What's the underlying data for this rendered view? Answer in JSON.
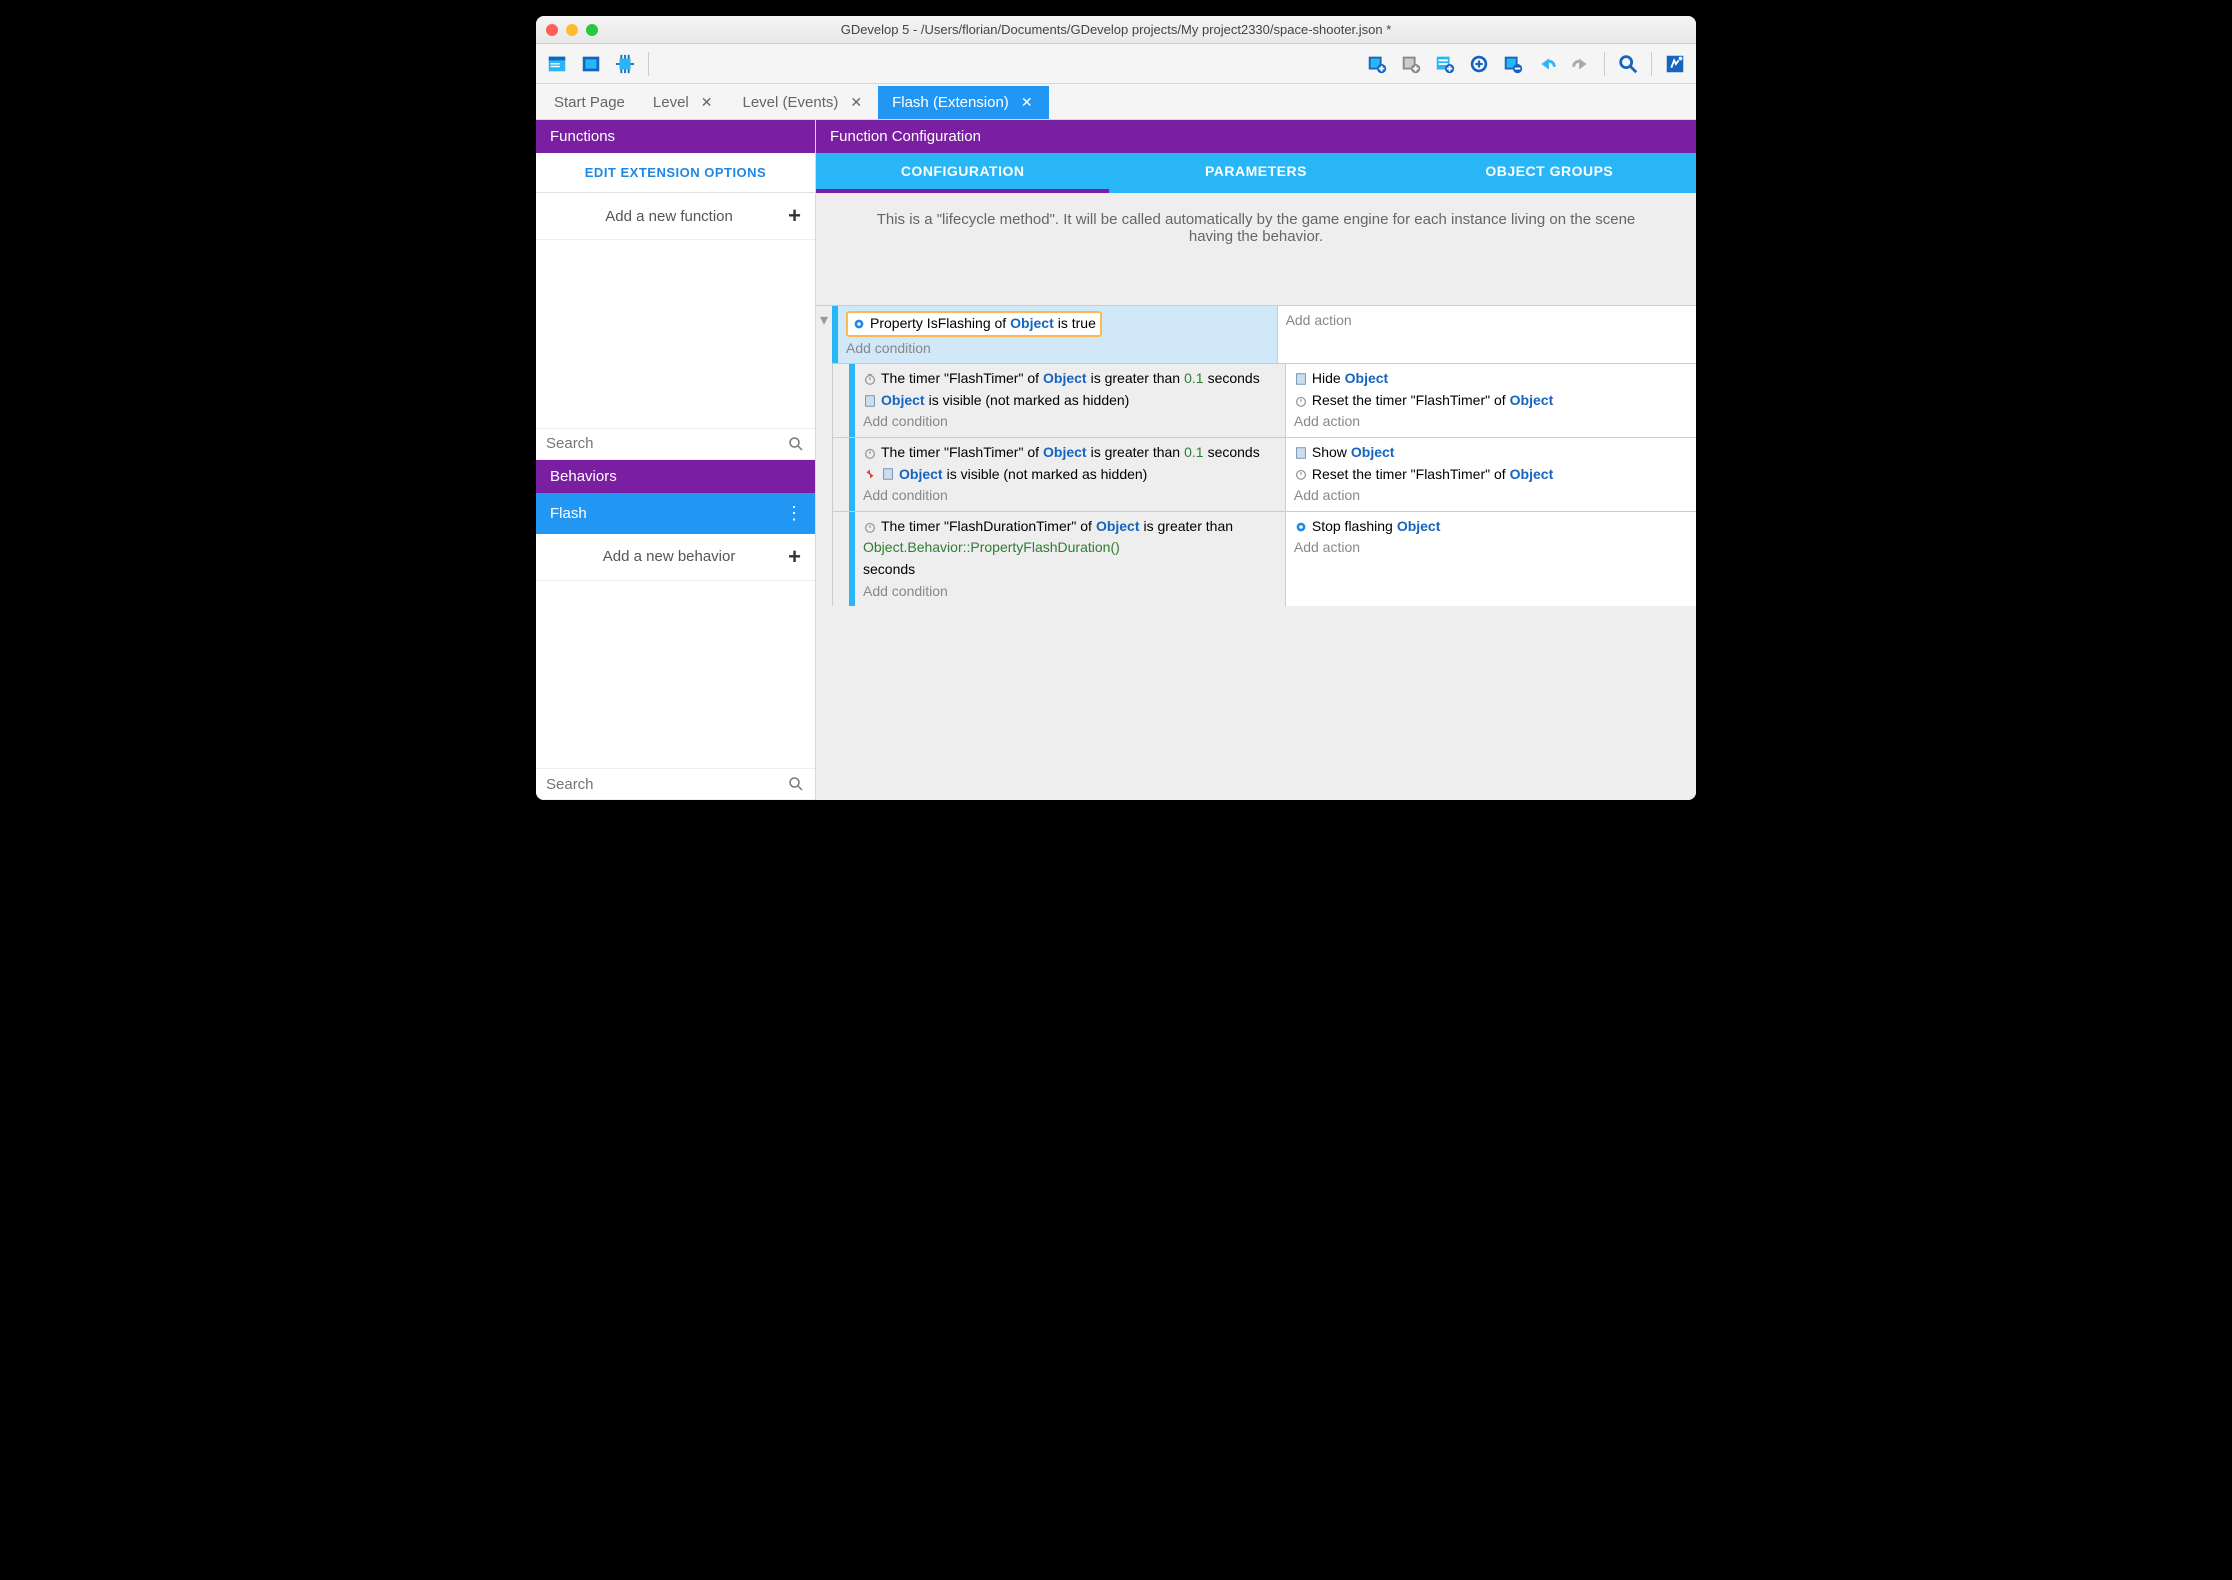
{
  "window": {
    "title": "GDevelop 5 - /Users/florian/Documents/GDevelop projects/My project2330/space-shooter.json *"
  },
  "tabs": [
    {
      "label": "Start Page",
      "closable": false
    },
    {
      "label": "Level",
      "closable": true
    },
    {
      "label": "Level (Events)",
      "closable": true
    },
    {
      "label": "Flash (Extension)",
      "closable": true,
      "active": true
    }
  ],
  "sidebar": {
    "functions_header": "Functions",
    "edit_ext": "EDIT EXTENSION OPTIONS",
    "add_function": "Add a new function",
    "search_placeholder": "Search",
    "behaviors_header": "Behaviors",
    "behavior_item": "Flash",
    "add_behavior": "Add a new behavior",
    "search2_placeholder": "Search"
  },
  "content": {
    "header": "Function Configuration",
    "tabs": {
      "config": "CONFIGURATION",
      "params": "PARAMETERS",
      "groups": "OBJECT GROUPS"
    },
    "desc": "This is a \"lifecycle method\". It will be called automatically by the game engine for each instance living on the scene having the behavior."
  },
  "ev": {
    "add_cond": "Add condition",
    "add_act": "Add action",
    "obj": "Object",
    "c1": {
      "pre": "Property IsFlashing of",
      "post": "is true"
    },
    "c2": {
      "t1": "The timer \"FlashTimer\" of",
      "t2": "is greater than",
      "t3": "seconds",
      "v": "0.1",
      "vis": "is visible (not marked as hidden)"
    },
    "a2": {
      "hide": "Hide",
      "reset": "Reset the timer \"FlashTimer\" of"
    },
    "a3": {
      "show": "Show"
    },
    "c4": {
      "t1": "The timer \"FlashDurationTimer\" of",
      "t2": "is greater than",
      "expr": "Object.Behavior::PropertyFlashDuration()",
      "t3": "seconds"
    },
    "a4": {
      "stop": "Stop flashing"
    }
  }
}
